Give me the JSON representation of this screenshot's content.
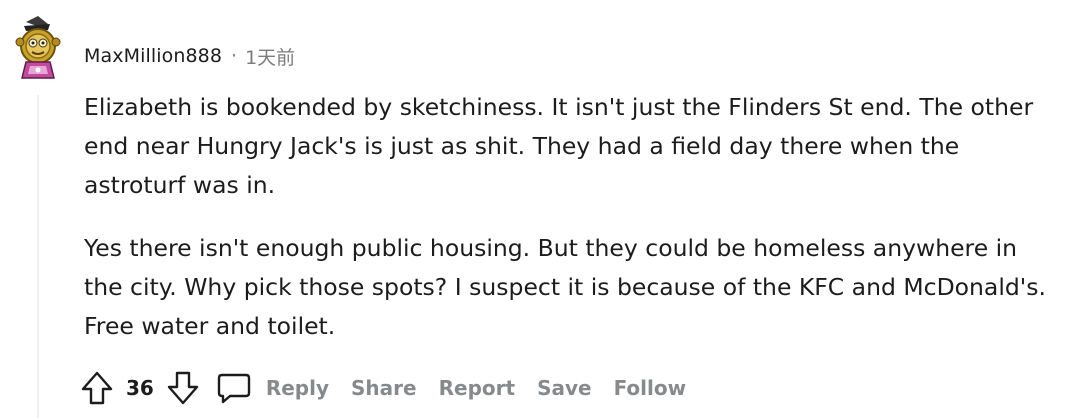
{
  "comment": {
    "author": "MaxMillion888",
    "separator": "·",
    "timestamp": "1天前",
    "paragraphs": [
      "Elizabeth is bookended by sketchiness. It isn't just the Flinders St end. The other\nend near Hungry Jack's is just as shit. They had a field day there when the\nastroturf was in.",
      "Yes there isn't enough public housing. But they could be homeless anywhere in\nthe city. Why pick those spots? I suspect it is because of the KFC and McDonald's.\nFree water and toilet."
    ],
    "vote_count": "36",
    "actions": {
      "reply": "Reply",
      "share": "Share",
      "report": "Report",
      "save": "Save",
      "follow": "Follow"
    },
    "icons": {
      "upvote": "upvote-arrow-icon",
      "downvote": "downvote-arrow-icon",
      "reply": "speech-bubble-icon"
    },
    "colors": {
      "text": "#1c1c1c",
      "muted": "#878a8c",
      "thread_line": "#edeff1"
    }
  }
}
